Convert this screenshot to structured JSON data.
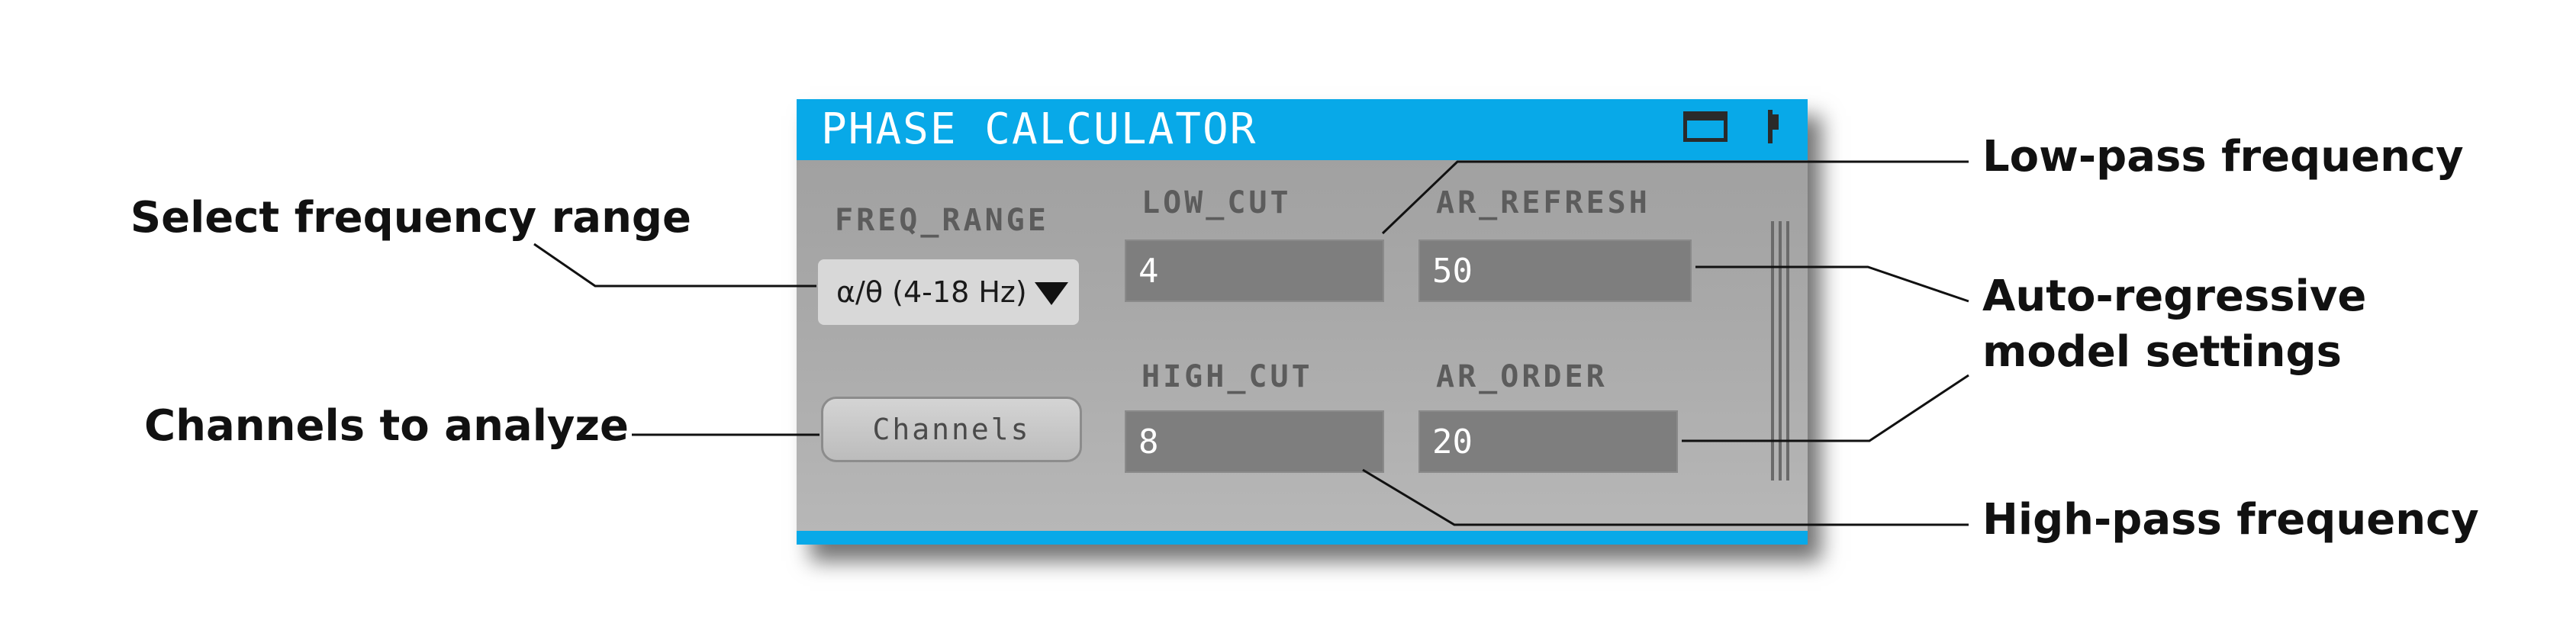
{
  "panel": {
    "title": "PHASE CALCULATOR",
    "title_bar_color": "#08a9e8",
    "icons": [
      "window-icon",
      "pin-icon"
    ],
    "freq_range": {
      "label": "FREQ_RANGE",
      "selected": "α/θ (4-18 Hz)"
    },
    "channels_button": "Channels",
    "low_cut": {
      "label": "LOW_CUT",
      "value": "4"
    },
    "high_cut": {
      "label": "HIGH_CUT",
      "value": "8"
    },
    "ar_refresh": {
      "label": "AR_REFRESH",
      "value": "50"
    },
    "ar_order": {
      "label": "AR_ORDER",
      "value": "20"
    }
  },
  "callouts": {
    "select_frequency_range": "Select frequency range",
    "channels_to_analyze": "Channels to analyze",
    "low_pass_frequency": "Low-pass frequency",
    "auto_regressive_line1": "Auto-regressive",
    "auto_regressive_line2": "model settings",
    "high_pass_frequency": "High-pass frequency"
  }
}
